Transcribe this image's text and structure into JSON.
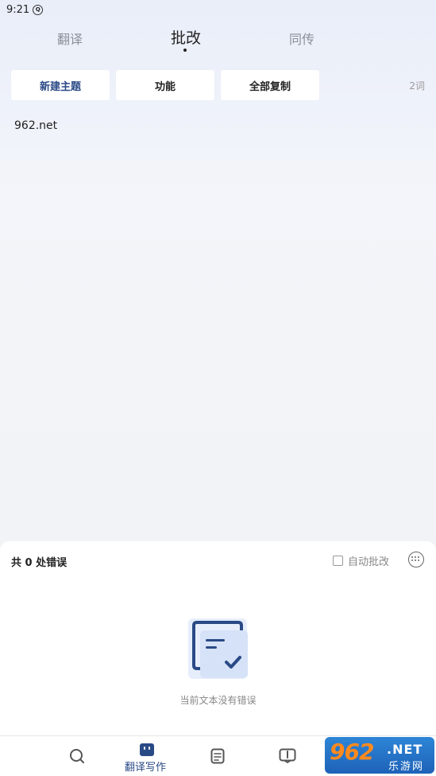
{
  "status_bar": {
    "time": "9:21",
    "indicator_icon": "notification-icon"
  },
  "top_tabs": [
    {
      "label": "翻译",
      "active": false
    },
    {
      "label": "批改",
      "active": true
    },
    {
      "label": "同传",
      "active": false
    }
  ],
  "toolbar": {
    "new_topic": "新建主题",
    "functions": "功能",
    "copy_all": "全部复制",
    "word_count": "2词"
  },
  "editor": {
    "text": "962.net"
  },
  "panel": {
    "error_summary": "共 0 处错误",
    "auto_correct_label": "自动批改",
    "auto_correct_checked": false,
    "empty_message": "当前文本没有错误"
  },
  "bottom_nav": [
    {
      "icon": "search-icon",
      "label": ""
    },
    {
      "icon": "robot-icon",
      "label": "翻译写作",
      "active": true
    },
    {
      "icon": "document-icon",
      "label": ""
    },
    {
      "icon": "book-icon",
      "label": ""
    }
  ],
  "watermark": {
    "logo": "962",
    "net": ".NET",
    "sub": "乐游网"
  },
  "colors": {
    "accent": "#2a4a86",
    "background": "#f2f3f6"
  }
}
